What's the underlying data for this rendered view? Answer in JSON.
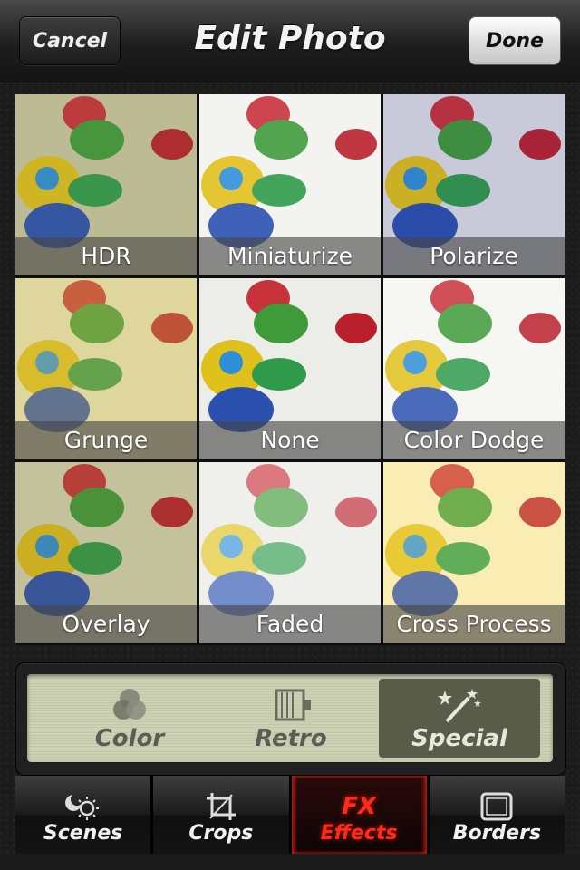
{
  "header": {
    "title": "Edit Photo",
    "cancel_label": "Cancel",
    "done_label": "Done"
  },
  "effects": [
    {
      "label": "HDR",
      "tone": "#c9c7a0",
      "tint": "rgba(120,120,80,0.15)"
    },
    {
      "label": "Miniaturize",
      "tone": "#f2f2ee",
      "tint": "rgba(255,255,255,0.1)"
    },
    {
      "label": "Polarize",
      "tone": "#dcdfe8",
      "tint": "rgba(60,60,120,0.12)"
    },
    {
      "label": "Grunge",
      "tone": "#ece8c8",
      "tint": "rgba(200,180,80,0.35)"
    },
    {
      "label": "None",
      "tone": "#ecede8",
      "tint": "rgba(255,255,255,0.0)"
    },
    {
      "label": "Color Dodge",
      "tone": "#f5f5f0",
      "tint": "rgba(255,255,255,0.15)"
    },
    {
      "label": "Overlay",
      "tone": "#d8d6b6",
      "tint": "rgba(120,110,60,0.2)"
    },
    {
      "label": "Faded",
      "tone": "#e6e8e2",
      "tint": "rgba(255,255,255,0.35)"
    },
    {
      "label": "Cross Process",
      "tone": "#f7efc0",
      "tint": "rgba(255,230,140,0.25)"
    }
  ],
  "categories": [
    {
      "label": "Color",
      "icon": "color-circles-icon",
      "active": false
    },
    {
      "label": "Retro",
      "icon": "retro-camera-icon",
      "active": false
    },
    {
      "label": "Special",
      "icon": "magic-wand-icon",
      "active": true
    }
  ],
  "tabs": [
    {
      "label": "Scenes",
      "icon": "sun-moon-icon",
      "active": false
    },
    {
      "label": "Crops",
      "icon": "crop-icon",
      "active": false
    },
    {
      "label": "Effects",
      "icon": "fx-icon",
      "icon_text": "FX",
      "active": true
    },
    {
      "label": "Borders",
      "icon": "frame-icon",
      "active": false
    }
  ],
  "colors": {
    "accent_red": "#ff2a1a",
    "lcd_bg": "#cdd1b4",
    "active_segment": "#5a5c4a"
  }
}
